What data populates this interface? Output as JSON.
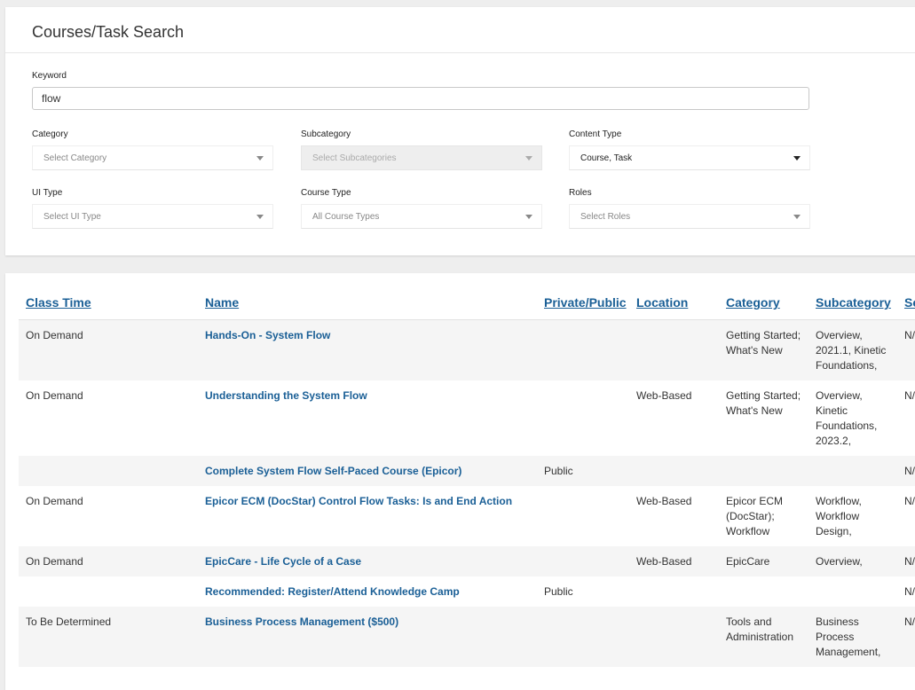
{
  "search": {
    "title": "Courses/Task Search",
    "keyword_label": "Keyword",
    "keyword_value": "flow",
    "category_label": "Category",
    "category_placeholder": "Select Category",
    "subcategory_label": "Subcategory",
    "subcategory_placeholder": "Select Subcategories",
    "content_type_label": "Content Type",
    "content_type_value": "Course, Task",
    "ui_type_label": "UI Type",
    "ui_type_placeholder": "Select UI Type",
    "course_type_label": "Course Type",
    "course_type_value": "All Course Types",
    "roles_label": "Roles",
    "roles_placeholder": "Select Roles"
  },
  "results": {
    "columns": [
      "Class Time",
      "Name",
      "Private/Public",
      "Location",
      "Category",
      "Subcategory",
      "Se"
    ],
    "rows": [
      {
        "class_time": "On Demand",
        "name": "Hands-On - System Flow",
        "privacy": "",
        "location": "",
        "category": "Getting Started; What's New",
        "subcategory": "Overview, 2021.1, Kinetic Foundations,",
        "extra": "N/"
      },
      {
        "class_time": "On Demand",
        "name": "Understanding the System Flow",
        "privacy": "",
        "location": "Web-Based",
        "category": "Getting Started; What's New",
        "subcategory": "Overview, Kinetic Foundations, 2023.2,",
        "extra": "N/"
      },
      {
        "class_time": "",
        "name": "Complete System Flow Self-Paced Course (Epicor)",
        "privacy": "Public",
        "location": "",
        "category": "",
        "subcategory": "",
        "extra": "N/"
      },
      {
        "class_time": "On Demand",
        "name": "Epicor ECM (DocStar) Control Flow Tasks: Is and End Action",
        "privacy": "",
        "location": "Web-Based",
        "category": "Epicor ECM (DocStar); Workflow",
        "subcategory": "Workflow, Workflow Design,",
        "extra": "N/"
      },
      {
        "class_time": "On Demand",
        "name": "EpicCare - Life Cycle of a Case",
        "privacy": "",
        "location": "Web-Based",
        "category": "EpicCare",
        "subcategory": "Overview,",
        "extra": "N/"
      },
      {
        "class_time": "",
        "name": "Recommended: Register/Attend Knowledge Camp",
        "privacy": "Public",
        "location": "",
        "category": "",
        "subcategory": "",
        "extra": "N/"
      },
      {
        "class_time": "To Be Determined",
        "name": "Business Process Management ($500)",
        "privacy": "",
        "location": "",
        "category": "Tools and Administration",
        "subcategory": "Business Process Management,",
        "extra": "N/"
      }
    ]
  },
  "colors": {
    "link": "#1a5f96",
    "row_alt": "#f5f5f5",
    "page_bg": "#eeeeee"
  }
}
